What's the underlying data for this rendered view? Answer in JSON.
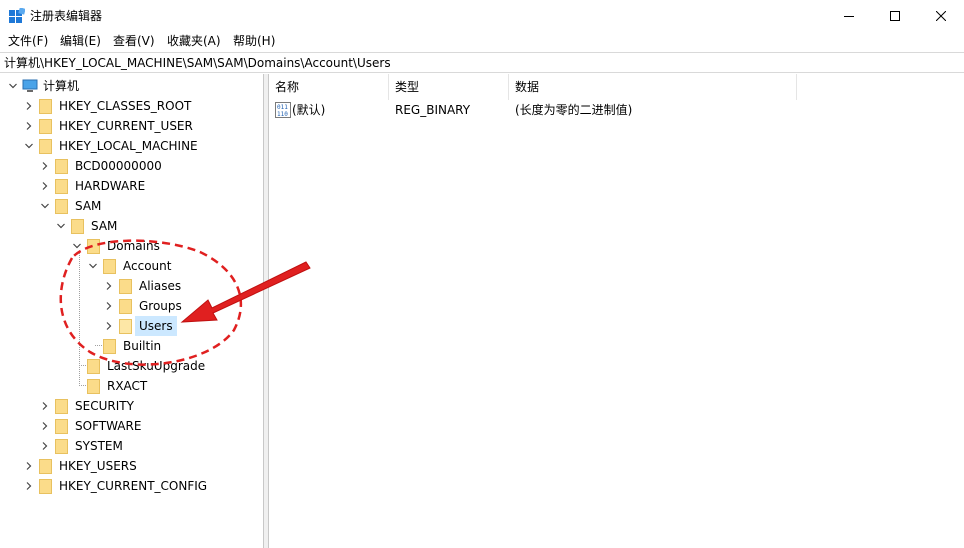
{
  "window": {
    "title": "注册表编辑器",
    "controls": [
      "minimize",
      "maximize",
      "close"
    ]
  },
  "menu": [
    {
      "label": "文件(F)"
    },
    {
      "label": "编辑(E)"
    },
    {
      "label": "查看(V)"
    },
    {
      "label": "收藏夹(A)"
    },
    {
      "label": "帮助(H)"
    }
  ],
  "address": "计算机\\HKEY_LOCAL_MACHINE\\SAM\\SAM\\Domains\\Account\\Users",
  "tree": [
    {
      "label": "计算机",
      "expanded": true,
      "icon": "computer-icon"
    },
    {
      "label": "HKEY_CLASSES_ROOT",
      "expanded": false
    },
    {
      "label": "HKEY_CURRENT_USER",
      "expanded": false
    },
    {
      "label": "HKEY_LOCAL_MACHINE",
      "expanded": true
    },
    {
      "label": "BCD00000000",
      "expanded": false
    },
    {
      "label": "HARDWARE",
      "expanded": false
    },
    {
      "label": "SAM",
      "expanded": true
    },
    {
      "label": "SAM",
      "expanded": true
    },
    {
      "label": "Domains",
      "expanded": true
    },
    {
      "label": "Account",
      "expanded": true
    },
    {
      "label": "Aliases",
      "expanded": false
    },
    {
      "label": "Groups",
      "expanded": false
    },
    {
      "label": "Users",
      "expanded": false,
      "selected": true
    },
    {
      "label": "Builtin",
      "expanded": false
    },
    {
      "label": "LastSkuUpgrade",
      "expanded": false
    },
    {
      "label": "RXACT",
      "expanded": false
    },
    {
      "label": "SECURITY",
      "expanded": false
    },
    {
      "label": "SOFTWARE",
      "expanded": false
    },
    {
      "label": "SYSTEM",
      "expanded": false
    },
    {
      "label": "HKEY_USERS",
      "expanded": false
    },
    {
      "label": "HKEY_CURRENT_CONFIG",
      "expanded": false
    }
  ],
  "columns": [
    {
      "label": "名称"
    },
    {
      "label": "类型"
    },
    {
      "label": "数据"
    }
  ],
  "values": [
    {
      "name": "(默认)",
      "type": "REG_BINARY",
      "data": "(长度为零的二进制值)",
      "icon": "binary-value-icon"
    }
  ],
  "annotation": {
    "color": "#e02020"
  }
}
